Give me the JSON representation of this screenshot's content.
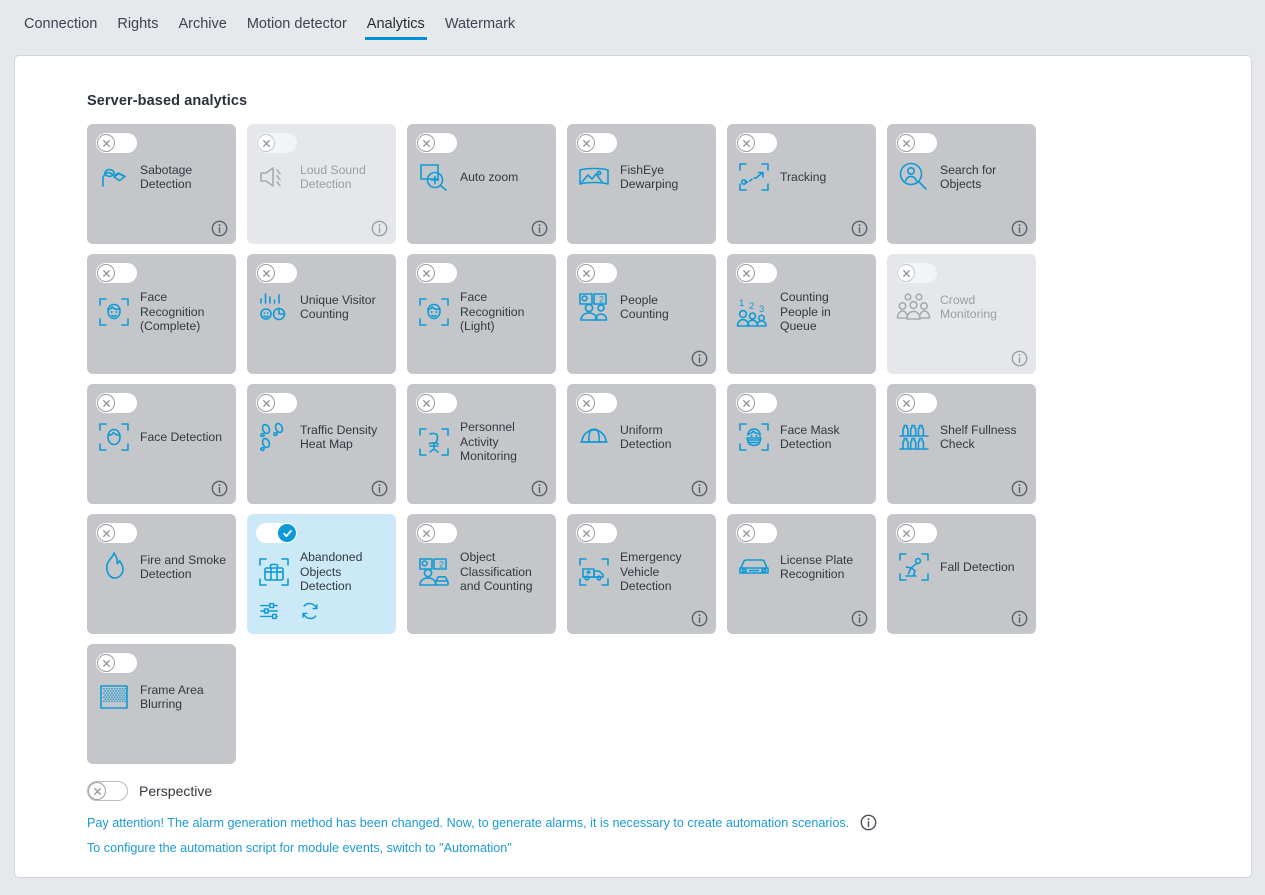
{
  "tabs": [
    {
      "label": "Connection",
      "active": false
    },
    {
      "label": "Rights",
      "active": false
    },
    {
      "label": "Archive",
      "active": false
    },
    {
      "label": "Motion detector",
      "active": false
    },
    {
      "label": "Analytics",
      "active": true
    },
    {
      "label": "Watermark",
      "active": false
    }
  ],
  "section": {
    "title": "Server-based analytics"
  },
  "colors": {
    "accent": "#0093d4",
    "icon_blue": "#0e9ad6",
    "card_bg": "#c5c6c9",
    "card_bg_disabled": "#e5e7ea",
    "card_bg_active": "#cbe9f7",
    "page_bg": "#e6e8ec",
    "panel_bg": "#ffffff",
    "text": "#32383f",
    "text_disabled": "#9a9ea5",
    "link": "#1d9ad4"
  },
  "cards": [
    {
      "label": "Sabotage Detection",
      "icon": "sabotage-icon",
      "enabled": false,
      "disabled": false,
      "info": true
    },
    {
      "label": "Loud Sound Detection",
      "icon": "loud-sound-icon",
      "enabled": false,
      "disabled": true,
      "info": true
    },
    {
      "label": "Auto zoom",
      "icon": "auto-zoom-icon",
      "enabled": false,
      "disabled": false,
      "info": true
    },
    {
      "label": "FishEye Dewarping",
      "icon": "fisheye-dewarping-icon",
      "enabled": false,
      "disabled": false,
      "info": false
    },
    {
      "label": "Tracking",
      "icon": "tracking-icon",
      "enabled": false,
      "disabled": false,
      "info": true
    },
    {
      "label": "Search for Objects",
      "icon": "search-objects-icon",
      "enabled": false,
      "disabled": false,
      "info": true
    },
    {
      "label": "Face Recognition (Complete)",
      "icon": "face-recognition-icon",
      "enabled": false,
      "disabled": false,
      "info": false
    },
    {
      "label": "Unique Visitor Counting",
      "icon": "unique-visitor-icon",
      "enabled": false,
      "disabled": false,
      "info": false
    },
    {
      "label": "Face Recognition (Light)",
      "icon": "face-recognition-icon",
      "enabled": false,
      "disabled": false,
      "info": false
    },
    {
      "label": "People Counting",
      "icon": "people-counting-icon",
      "enabled": false,
      "disabled": false,
      "info": true
    },
    {
      "label": "Counting People in Queue",
      "icon": "queue-counting-icon",
      "enabled": false,
      "disabled": false,
      "info": false
    },
    {
      "label": "Crowd Monitoring",
      "icon": "crowd-monitoring-icon",
      "enabled": false,
      "disabled": true,
      "info": true
    },
    {
      "label": "Face Detection",
      "icon": "face-detection-icon",
      "enabled": false,
      "disabled": false,
      "info": true
    },
    {
      "label": "Traffic Density Heat Map",
      "icon": "footsteps-icon",
      "enabled": false,
      "disabled": false,
      "info": true
    },
    {
      "label": "Personnel Activity Monitoring",
      "icon": "chair-icon",
      "enabled": false,
      "disabled": false,
      "info": true
    },
    {
      "label": "Uniform Detection",
      "icon": "helmet-icon",
      "enabled": false,
      "disabled": false,
      "info": true
    },
    {
      "label": "Face Mask Detection",
      "icon": "face-mask-icon",
      "enabled": false,
      "disabled": false,
      "info": false
    },
    {
      "label": "Shelf Fullness Check",
      "icon": "shelf-icon",
      "enabled": false,
      "disabled": false,
      "info": true
    },
    {
      "label": "Fire and Smoke Detection",
      "icon": "flame-icon",
      "enabled": false,
      "disabled": false,
      "info": false
    },
    {
      "label": "Abandoned Objects Detection",
      "icon": "suitcase-icon",
      "enabled": true,
      "disabled": false,
      "info": false,
      "actions": [
        "settings-sliders-icon",
        "refresh-icon"
      ]
    },
    {
      "label": "Object Classification and Counting",
      "icon": "object-classification-icon",
      "enabled": false,
      "disabled": false,
      "info": false
    },
    {
      "label": "Emergency Vehicle Detection",
      "icon": "ambulance-icon",
      "enabled": false,
      "disabled": false,
      "info": true
    },
    {
      "label": "License Plate Recognition",
      "icon": "car-icon",
      "enabled": false,
      "disabled": false,
      "info": true
    },
    {
      "label": "Fall Detection",
      "icon": "fall-detection-icon",
      "enabled": false,
      "disabled": false,
      "info": true
    },
    {
      "label": "Frame Area Blurring",
      "icon": "frame-blur-icon",
      "enabled": false,
      "disabled": false,
      "info": false
    }
  ],
  "perspective": {
    "label": "Perspective",
    "enabled": false
  },
  "notes": [
    {
      "text": "Pay attention! The alarm generation method has been changed. Now, to generate alarms, it is necessary to create automation scenarios.",
      "info": true
    },
    {
      "text": "To configure the automation script for module events, switch to \"Automation\"",
      "info": false
    }
  ]
}
